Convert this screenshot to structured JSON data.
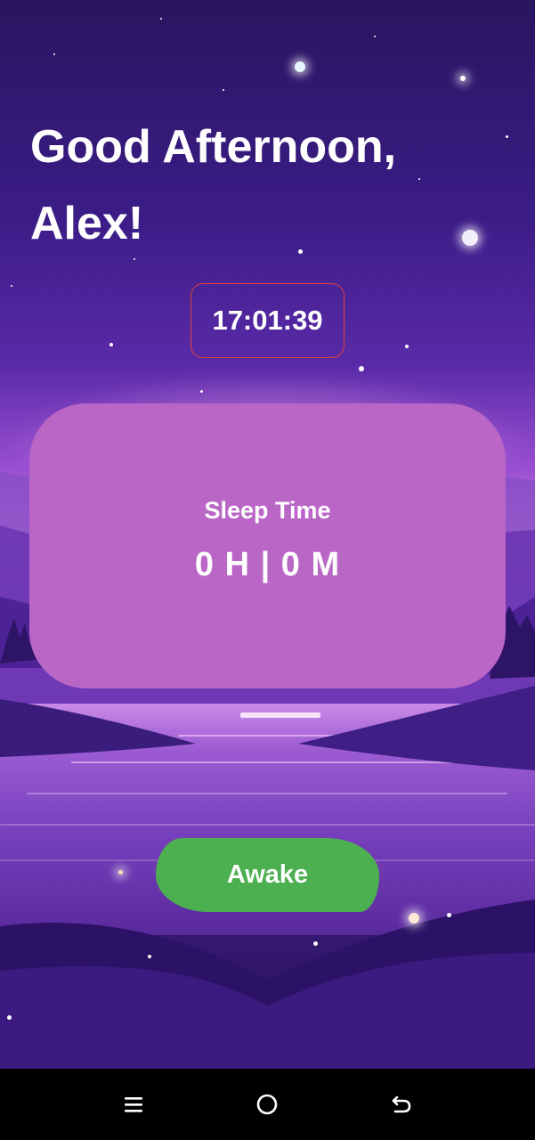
{
  "greeting": {
    "line1": "Good Afternoon,",
    "line2": "Alex!"
  },
  "clock": {
    "time": "17:01:39"
  },
  "sleep_card": {
    "label": "Sleep Time",
    "value": "0 H | 0 M"
  },
  "awake_button": {
    "label": "Awake",
    "color": "#4caf50"
  },
  "navbar": {
    "items": [
      {
        "icon": "menu-lines-icon"
      },
      {
        "icon": "home-circle-icon"
      },
      {
        "icon": "back-arrow-icon"
      }
    ]
  },
  "colors": {
    "card": "#b966c6",
    "clock_border": "#e0423e"
  }
}
